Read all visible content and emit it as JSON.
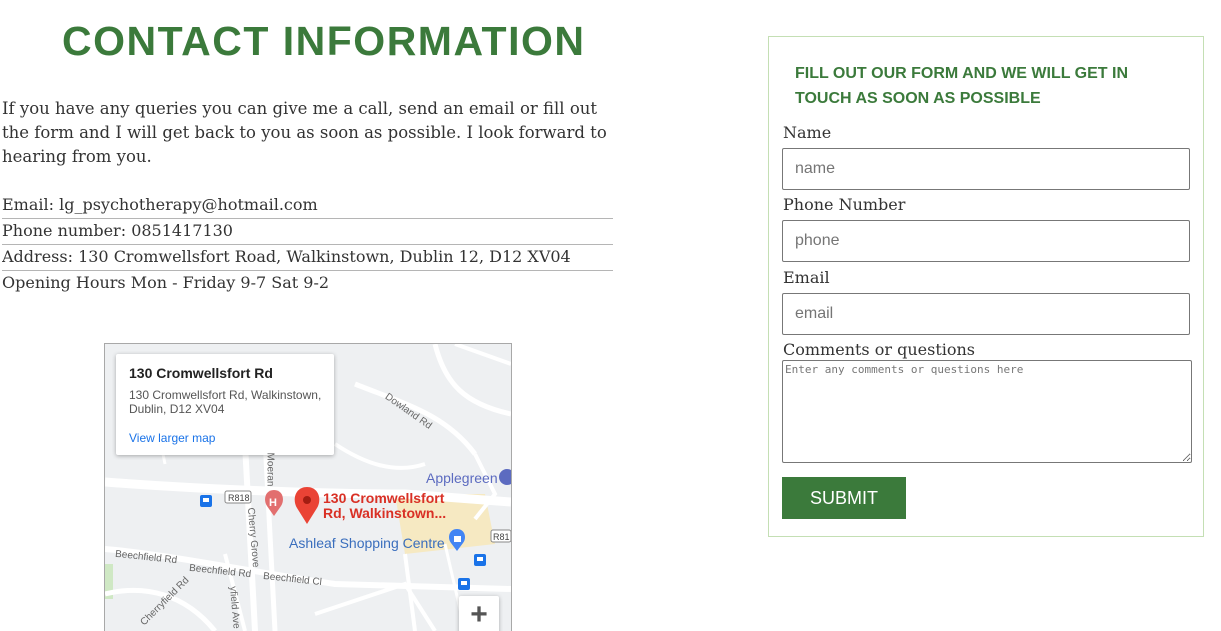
{
  "page": {
    "title": "CONTACT INFORMATION",
    "intro": "If you have any queries you can give me a call, send an email or fill out the form and I will get back to you as soon as possible. I look forward to hearing from you."
  },
  "contact": {
    "email_label": "Email: ",
    "email_value": "lg_psychotherapy@hotmail.com",
    "phone_label": "Phone number: ",
    "phone_value": "0851417130",
    "address_label": "Address: ",
    "address_value": "130 Cromwellsfort Road, Walkinstown, Dublin 12, D12 XV04",
    "hours_label": "Opening Hours ",
    "hours_value": "Mon - Friday 9-7 Sat 9-2"
  },
  "map": {
    "card_title": "130 Cromwellsfort Rd",
    "card_address": "130 Cromwellsfort Rd, Walkinstown, Dublin, D12 XV04",
    "larger_map_link": "View larger map",
    "pin_label_line1": "130 Cromwellsfort",
    "pin_label_line2": "Rd, Walkinstown...",
    "poi_applegreen": "Applegreen",
    "poi_ashleaf": "Ashleaf Shopping Centre",
    "road_r818": "R818",
    "road_r81": "R81",
    "street_dowland": "Dowland Rd",
    "street_beechfield": "Beechfield Rd",
    "street_beechfield2": "Beechfield Rd",
    "street_beechfield_cl": "Beechfield Cl",
    "street_cherry": "Cherry Grove",
    "street_cherryfield": "Cherryfield Rd",
    "street_moeran": "Moeran",
    "street_fieldave": "yfield Ave",
    "zoom_in": "+",
    "colors": {
      "pin": "#ea4335",
      "transit": "#1a73e8",
      "shopping": "#f6e9c2"
    }
  },
  "form": {
    "heading": "FILL OUT OUR FORM AND WE WILL GET IN TOUCH AS SOON AS POSSIBLE",
    "name_label": "Name",
    "name_placeholder": "name",
    "phone_label": "Phone Number",
    "phone_placeholder": "phone",
    "email_label": "Email",
    "email_placeholder": "email",
    "comments_label": "Comments or questions",
    "comments_placeholder": "Enter any comments or questions here",
    "submit_label": "SUBMIT"
  },
  "theme": {
    "accent": "#3b7a3b",
    "panel_border": "#c4dfb4"
  }
}
